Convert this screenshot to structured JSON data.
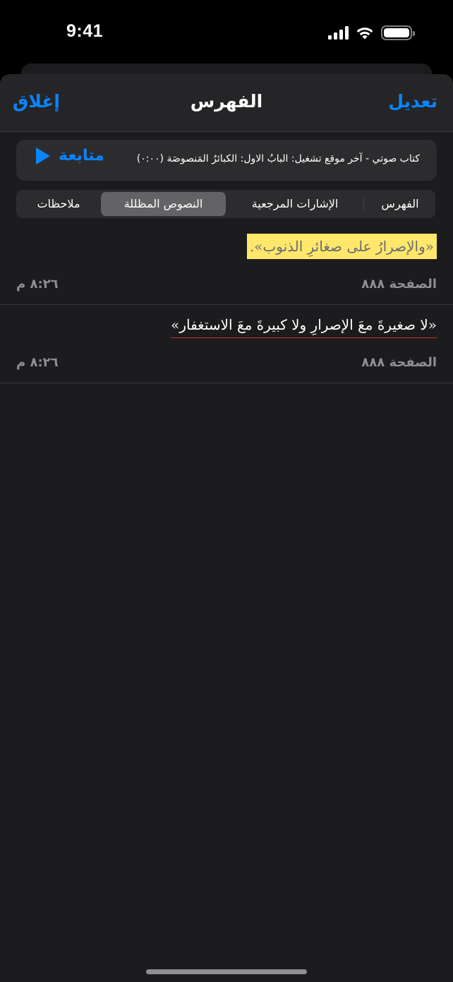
{
  "status": {
    "time": "9:41",
    "icons": [
      "cellular-signal-icon",
      "wifi-icon",
      "battery-icon"
    ]
  },
  "nav": {
    "title": "الفهرس",
    "edit_label": "تعديل",
    "close_label": "إغلاق"
  },
  "audio": {
    "text": "كتاب صوتي - آخر موقع تشغيل: البابُ الاول: الكبائرُ المَنصوصَة (٠:٠٠)",
    "continue_label": "متابعة",
    "icon": "play-icon"
  },
  "tabs": [
    {
      "label": "الفهرس",
      "active": false
    },
    {
      "label": "الإشارات المرجعية",
      "active": false
    },
    {
      "label": "النصوص المظللة",
      "active": true
    },
    {
      "label": "ملاحظات",
      "active": false
    }
  ],
  "entries": [
    {
      "quote": "«والإصرارُ على صغائرِ الذنوب».",
      "style": "highlight",
      "page": "الصفحة ٨٨٨",
      "time": "٨:٢٦ م"
    },
    {
      "quote": "«لا صغيرةَ معَ الإصرارِ ولا كبيرةَ معَ الاستغفار»",
      "style": "underline",
      "page": "الصفحة ٨٨٨",
      "time": "٨:٢٦ م"
    }
  ],
  "colors": {
    "accent": "#0a84ff",
    "highlight": "#ffe76c",
    "underline": "#d0302f",
    "background": "#1c1c1e"
  }
}
